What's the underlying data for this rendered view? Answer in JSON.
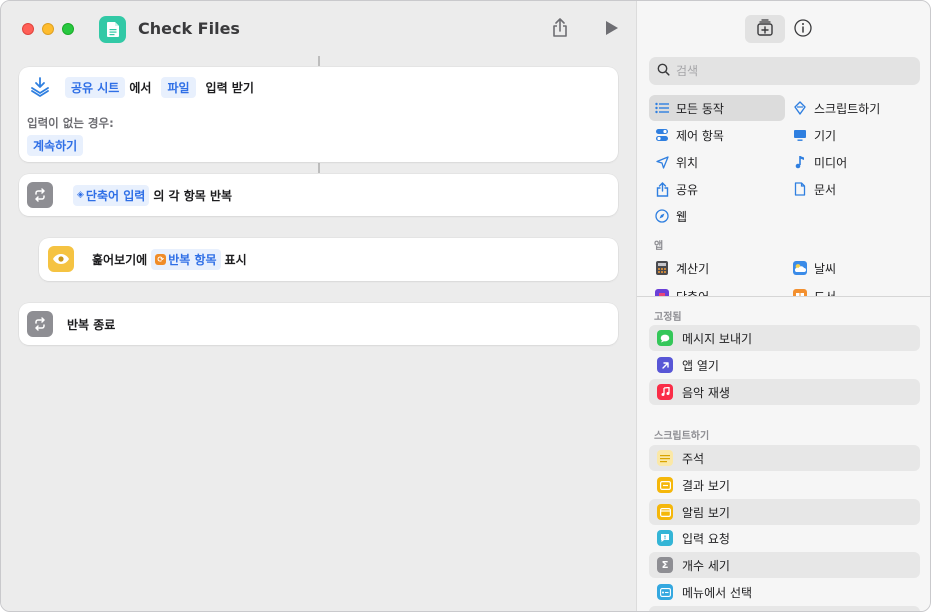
{
  "window": {
    "title": "Check Files"
  },
  "editor": {
    "receive_action": {
      "source_token": "공유 시트",
      "from_word": "에서",
      "type_token": "파일",
      "suffix": "입력 받기",
      "no_input_label": "입력이 없는 경우:",
      "no_input_value": "계속하기"
    },
    "repeat_action": {
      "input_token": "단축어 입력",
      "suffix": "의 각 항목 반복"
    },
    "quicklook_action": {
      "prefix": "훑어보기에",
      "item_token": "반복 항목",
      "suffix": "표시"
    },
    "end_repeat_action": {
      "label": "반복 종료"
    }
  },
  "sidebar": {
    "search_placeholder": "검색",
    "categories": [
      {
        "label": "모든 동작",
        "icon": "list-icon",
        "selected": true
      },
      {
        "label": "스크립트하기",
        "icon": "script-icon",
        "selected": false
      },
      {
        "label": "제어 항목",
        "icon": "toggle-icon",
        "selected": false
      },
      {
        "label": "기기",
        "icon": "display-icon",
        "selected": false
      },
      {
        "label": "위치",
        "icon": "location-arrow-icon",
        "selected": false
      },
      {
        "label": "미디어",
        "icon": "music-note-icon",
        "selected": false
      },
      {
        "label": "공유",
        "icon": "share-icon",
        "selected": false
      },
      {
        "label": "문서",
        "icon": "document-icon",
        "selected": false
      },
      {
        "label": "웹",
        "icon": "compass-icon",
        "selected": false
      }
    ],
    "apps_label": "앱",
    "apps": [
      {
        "label": "계산기",
        "icon": "calculator-icon"
      },
      {
        "label": "날씨",
        "icon": "weather-icon"
      },
      {
        "label": "단축어",
        "icon": "shortcuts-icon"
      },
      {
        "label": "도서",
        "icon": "books-icon"
      }
    ],
    "pinned_label": "고정됨",
    "pinned": [
      {
        "label": "메시지 보내기",
        "icon": "messages-icon",
        "color": "#34c759"
      },
      {
        "label": "앱 열기",
        "icon": "open-app-icon",
        "color": "#5856d6"
      },
      {
        "label": "음악 재생",
        "icon": "music-icon",
        "color": "#fa2d48"
      }
    ],
    "scripting_label": "스크립트하기",
    "scripting": [
      {
        "label": "주석",
        "icon": "comment-icon",
        "color": "#f2c94c"
      },
      {
        "label": "결과 보기",
        "icon": "show-result-icon",
        "color": "#f5b70a"
      },
      {
        "label": "알림 보기",
        "icon": "alert-icon",
        "color": "#f5b70a"
      },
      {
        "label": "입력 요청",
        "icon": "ask-input-icon",
        "color": "#34b5d6"
      },
      {
        "label": "개수 세기",
        "icon": "sigma-icon",
        "color": "#8e8e93"
      },
      {
        "label": "메뉴에서 선택",
        "icon": "menu-icon",
        "color": "#34a8e0"
      }
    ]
  }
}
